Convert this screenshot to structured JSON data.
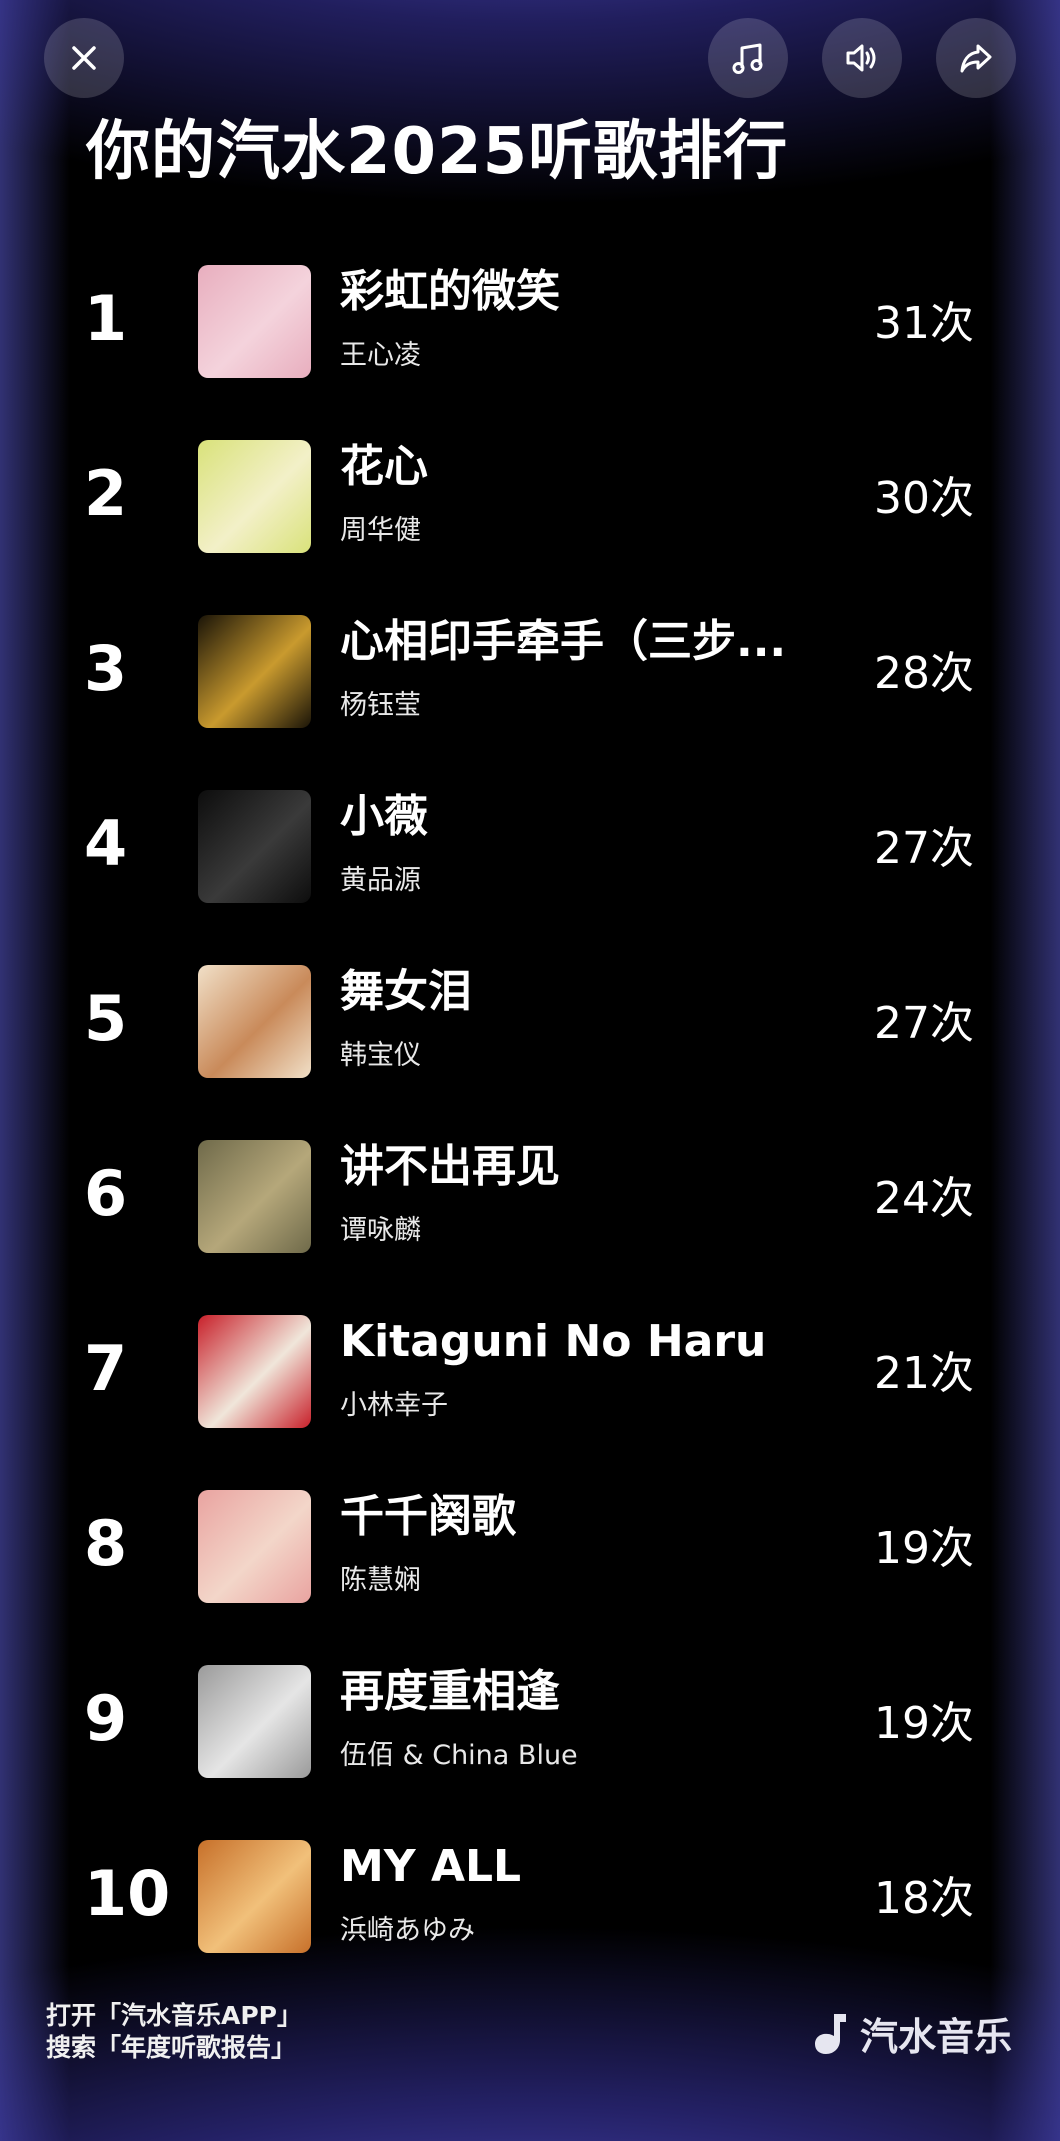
{
  "header": {
    "title": "你的汽水2025听歌排行"
  },
  "buttons": {
    "close": "close-icon",
    "music": "music-note-icon",
    "sound": "volume-icon",
    "share": "share-icon"
  },
  "songs": [
    {
      "rank": "1",
      "title": "彩虹的微笑",
      "artist": "王心凌",
      "count": "31次",
      "cover_colors": [
        "#e8aebe",
        "#f4d3dc"
      ]
    },
    {
      "rank": "2",
      "title": "花心",
      "artist": "周华健",
      "count": "30次",
      "cover_colors": [
        "#d9e27a",
        "#f3f0c8"
      ]
    },
    {
      "rank": "3",
      "title": "心相印手牵手（三步...",
      "artist": "杨钰莹",
      "count": "28次",
      "cover_colors": [
        "#1a1408",
        "#c99a2e"
      ]
    },
    {
      "rank": "4",
      "title": "小薇",
      "artist": "黄品源",
      "count": "27次",
      "cover_colors": [
        "#0d0d0d",
        "#3a3a3a"
      ]
    },
    {
      "rank": "5",
      "title": "舞女泪",
      "artist": "韩宝仪",
      "count": "27次",
      "cover_colors": [
        "#f1e0c8",
        "#c98a5a"
      ]
    },
    {
      "rank": "6",
      "title": "讲不出再见",
      "artist": "谭咏麟",
      "count": "24次",
      "cover_colors": [
        "#6f6a4a",
        "#b5a77a"
      ]
    },
    {
      "rank": "7",
      "title": "Kitaguni No Haru",
      "artist": "小林幸子",
      "count": "21次",
      "cover_colors": [
        "#c8202a",
        "#f0e6da"
      ]
    },
    {
      "rank": "8",
      "title": "千千阕歌",
      "artist": "陈慧娴",
      "count": "19次",
      "cover_colors": [
        "#e9a3a0",
        "#f3d6c9"
      ]
    },
    {
      "rank": "9",
      "title": "再度重相逢",
      "artist": "伍佰 & China Blue",
      "count": "19次",
      "cover_colors": [
        "#9a9a9a",
        "#e5e5e5"
      ]
    },
    {
      "rank": "10",
      "title": "MY ALL",
      "artist": "浜崎あゆみ",
      "count": "18次",
      "cover_colors": [
        "#c7702a",
        "#f1c07a"
      ]
    }
  ],
  "footer": {
    "line1": "打开「汽水音乐APP」",
    "line2": "搜索「年度听歌报告」",
    "brand": "汽水音乐",
    "brand_icon": "qishui-logo-icon"
  }
}
